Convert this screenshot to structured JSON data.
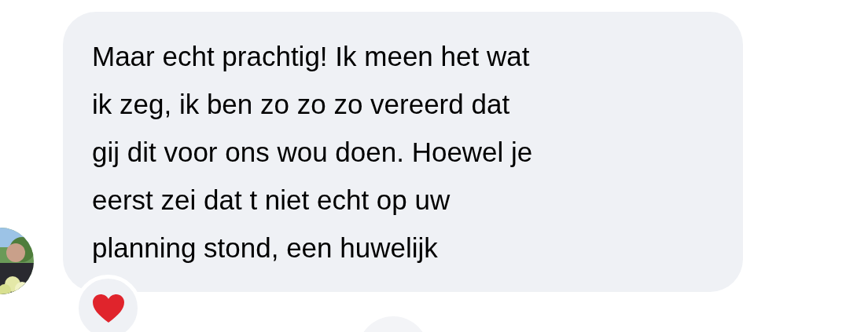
{
  "message": {
    "lines": [
      "Maar echt prachtig! Ik meen het wat",
      "ik zeg, ik ben zo zo zo vereerd dat",
      "gij dit voor ons wou doen. Hoewel je",
      "eerst zei dat t niet echt op uw",
      "planning stond, een huwelijk"
    ],
    "reactions": [
      {
        "kind": "heart"
      }
    ]
  }
}
